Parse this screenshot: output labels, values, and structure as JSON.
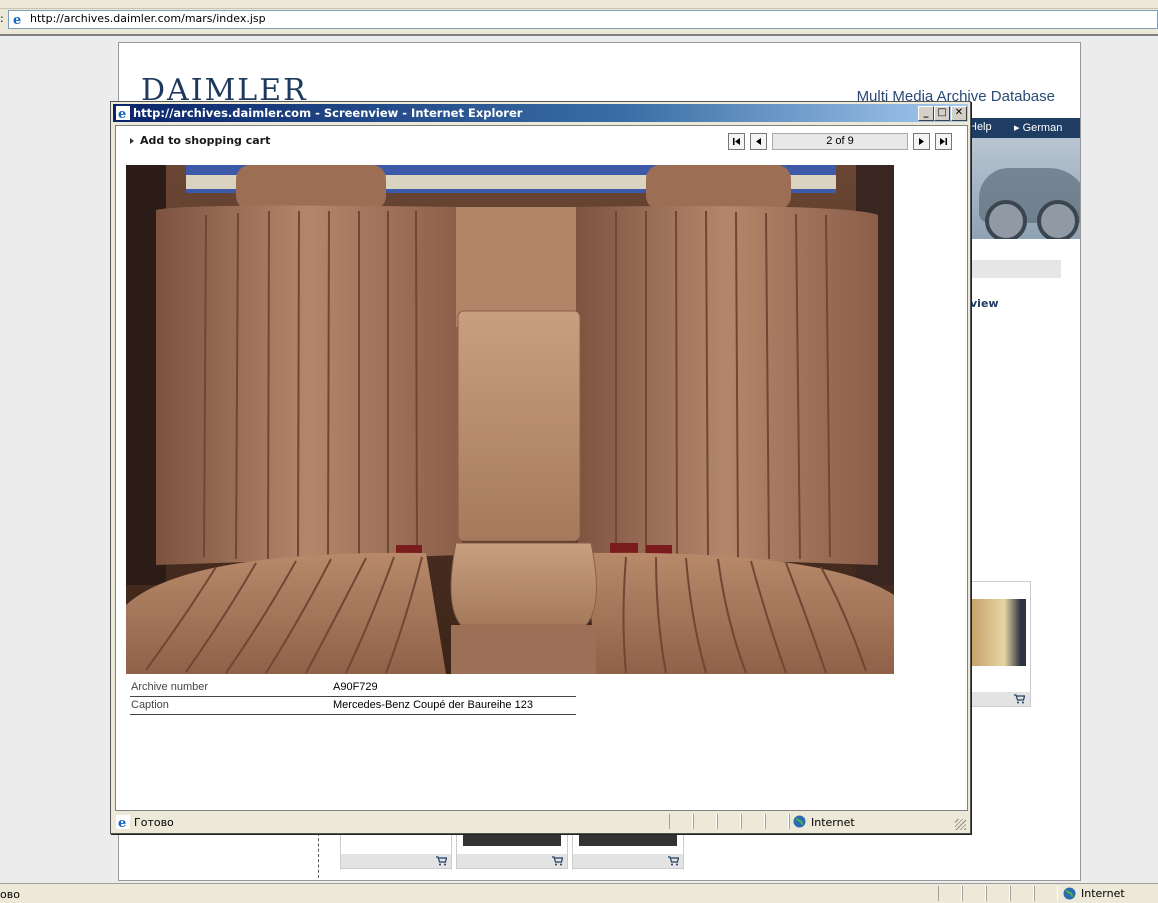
{
  "browser": {
    "address_url": "http://archives.daimler.com/mars/index.jsp",
    "status_text": "ово",
    "zone_label": "Internet"
  },
  "background_page": {
    "logo": "DAIMLER",
    "site_title": "Multi Media Archive Database",
    "nav": {
      "help": "Help",
      "german": "German"
    },
    "view_link": "view"
  },
  "popup": {
    "title": "http://archives.daimler.com - Screenview - Internet Explorer",
    "add_to_cart": "Add to shopping cart",
    "pager": {
      "position": "2 of 9"
    },
    "metadata": [
      {
        "label": "Archive number",
        "value": "A90F729"
      },
      {
        "label": "Caption",
        "value": "Mercedes-Benz Coupé der Baureihe 123"
      }
    ],
    "status_text": "Готово",
    "zone_label": "Internet"
  },
  "colors": {
    "brand_navy": "#1f3d63",
    "titlebar_start": "#0a246a",
    "titlebar_end": "#a6caf0",
    "leather": "#a97a5c"
  },
  "icons": [
    "ie-icon",
    "first-page-icon",
    "prev-page-icon",
    "next-page-icon",
    "last-page-icon",
    "minimize-icon",
    "maximize-icon",
    "close-icon",
    "cart-icon",
    "globe-icon"
  ]
}
